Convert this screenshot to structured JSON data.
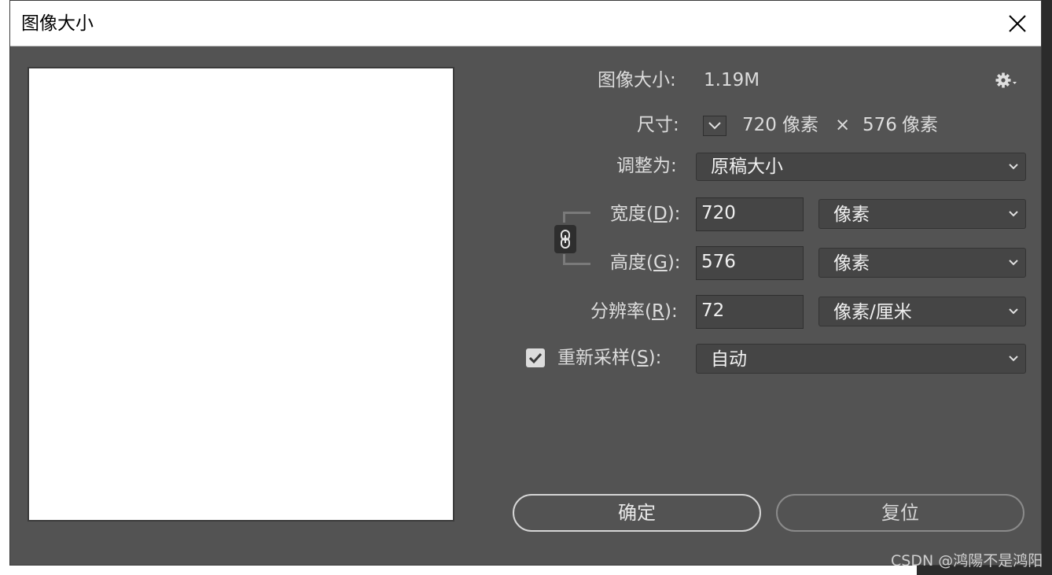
{
  "window": {
    "title": "图像大小"
  },
  "image_size": {
    "label": "图像大小:",
    "value": "1.19M"
  },
  "dimensions": {
    "label": "尺寸:",
    "width_value": "720",
    "width_unit": "像素",
    "separator": "×",
    "height_value": "576",
    "height_unit": "像素"
  },
  "fit_to": {
    "label": "调整为:",
    "value": "原稿大小"
  },
  "width": {
    "label_prefix": "宽度(",
    "label_key": "D",
    "label_suffix": "):",
    "value": "720",
    "unit": "像素"
  },
  "height": {
    "label_prefix": "高度(",
    "label_key": "G",
    "label_suffix": "):",
    "value": "576",
    "unit": "像素"
  },
  "resolution": {
    "label_prefix": "分辨率(",
    "label_key": "R",
    "label_suffix": "):",
    "value": "72",
    "unit": "像素/厘米"
  },
  "resample": {
    "label_prefix": "重新采样(",
    "label_key": "S",
    "label_suffix": "):",
    "checked": true,
    "value": "自动"
  },
  "buttons": {
    "ok": "确定",
    "reset": "复位"
  },
  "watermark": "CSDN @鸿陽不是鸿阳",
  "icons": {
    "close": "close-icon",
    "gear": "gear-icon",
    "link": "link-icon",
    "chevron": "chevron-down-icon",
    "check": "check-icon"
  }
}
